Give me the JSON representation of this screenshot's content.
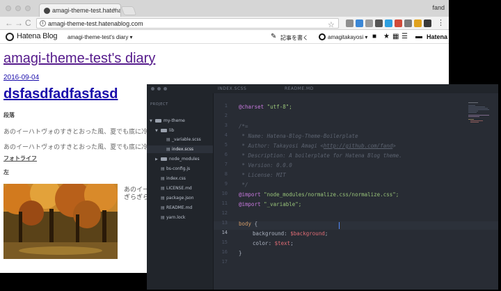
{
  "browser": {
    "tab_title": "amagi-theme-test.hatenablog.com",
    "profile_name": "fand",
    "url": "amagi-theme-test.hatenablog.com",
    "nav": {
      "back": "←",
      "forward": "→",
      "reload": "C"
    }
  },
  "hatena_bar": {
    "logo": "Hatena Blog",
    "blog_select": "amagi-theme-test's diary ▾",
    "write": "記事を書く",
    "user": "amagitakayosi ▾",
    "brand": "Hatena"
  },
  "blog": {
    "title": "amagi-theme-test's diary",
    "date": "2016-09-04",
    "post_title": "dsfasdfadfasfasd",
    "heading1": "段落",
    "para1": "あのイーハトヴォのすきとおった風、夏でも底に冷たさをもつ青いそら",
    "para2": "あのイーハトヴォのすきとおった風、夏でも底に冷たさをもつ青いそら",
    "photo_life": "フォトライフ",
    "left_label": "左",
    "caption1": "あのイーハトヴォ",
    "caption2": "ぎらぎらひかる"
  },
  "editor": {
    "tabs": [
      "INDEX.SCSS",
      "README.MD"
    ],
    "project_label": "PROJECT",
    "tree": [
      {
        "label": "my-theme",
        "kind": "dir"
      },
      {
        "label": "lib",
        "kind": "dir"
      },
      {
        "label": "_variable.scss",
        "kind": "file"
      },
      {
        "label": "index.scss",
        "kind": "file"
      },
      {
        "label": "node_modules",
        "kind": "dir"
      },
      {
        "label": "bs-config.js",
        "kind": "file"
      },
      {
        "label": "index.css",
        "kind": "file"
      },
      {
        "label": "LICENSE.md",
        "kind": "file"
      },
      {
        "label": "package.json",
        "kind": "file"
      },
      {
        "label": "README.md",
        "kind": "file"
      },
      {
        "label": "yarn.lock",
        "kind": "file"
      }
    ],
    "line_numbers": [
      "1",
      "2",
      "3",
      "4",
      "5",
      "6",
      "7",
      "8",
      "9",
      "10",
      "11",
      "12",
      "13",
      "14",
      "15",
      "16",
      "17"
    ],
    "current_line": "14",
    "code": {
      "charset_kw": "@charset",
      "charset_val": "\"utf-8\";",
      "c_open": "/*=",
      "c_name": " * Name: Hatena-Blog-Theme-Boilerplate",
      "c_author": " * Author: Takayosi Amagi <",
      "c_author_url": "http://github.com/fand",
      "c_author_end": ">",
      "c_desc": " * Description: A boilerplate for Hatena Blog theme.",
      "c_ver": " * Version: 0.0.0",
      "c_lic": " * License: MIT",
      "c_close": " */",
      "import_kw": "@import",
      "import1": "\"node_modules/normalize.css/normalize.css\";",
      "import2": "\"_variable\";",
      "body_sel": "body",
      "brace_open": " {",
      "bg_prop": "background: ",
      "bg_val": "$background",
      "color_prop": "color: ",
      "color_val": "$text",
      "semi": ";",
      "brace_close": "}"
    }
  }
}
